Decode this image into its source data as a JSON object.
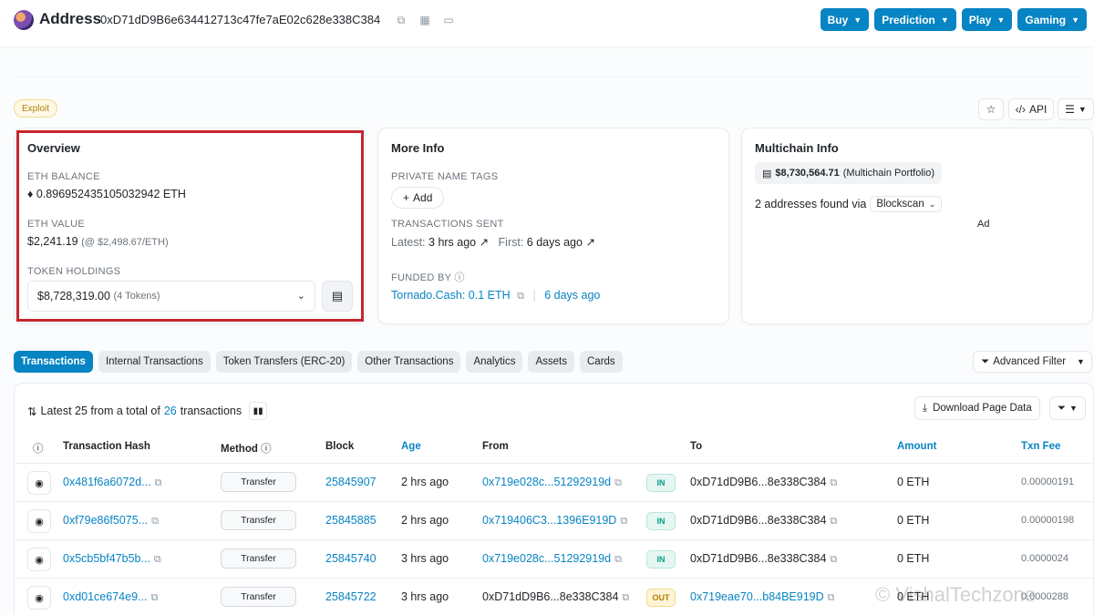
{
  "header": {
    "title": "Address",
    "address": "0xD71dD9B6e634412713c47fe7aE02c628e338C384",
    "nav": [
      "Buy",
      "Prediction",
      "Play",
      "Gaming"
    ]
  },
  "badge": {
    "label": "Exploit"
  },
  "toolbar": {
    "api_label": "API"
  },
  "overview": {
    "title": "Overview",
    "eth_balance_label": "ETH BALANCE",
    "eth_balance": "0.896952435105032942 ETH",
    "eth_value_label": "ETH VALUE",
    "eth_value": "$2,241.19",
    "eth_price": "(@ $2,498.67/ETH)",
    "token_holdings_label": "TOKEN HOLDINGS",
    "token_value": "$8,728,319.00",
    "token_count": "(4 Tokens)"
  },
  "more_info": {
    "title": "More Info",
    "private_tags_label": "PRIVATE NAME TAGS",
    "add_label": "Add",
    "tx_sent_label": "TRANSACTIONS SENT",
    "latest_label": "Latest:",
    "latest_value": "3 hrs ago",
    "first_label": "First:",
    "first_value": "6 days ago",
    "funded_by_label": "FUNDED BY",
    "funded_by_value": "Tornado.Cash: 0.1 ETH",
    "funded_by_age": "6 days ago"
  },
  "multichain": {
    "title": "Multichain Info",
    "portfolio_value": "$8,730,564.71",
    "portfolio_label": "(Multichain Portfolio)",
    "found_text": "2 addresses found via",
    "found_via": "Blockscan",
    "ad_label": "Ad"
  },
  "tabs": [
    "Transactions",
    "Internal Transactions",
    "Token Transfers (ERC-20)",
    "Other Transactions",
    "Analytics",
    "Assets",
    "Cards"
  ],
  "advanced_filter_label": "Advanced Filter",
  "table": {
    "summary_prefix": "Latest 25 from a total of",
    "summary_count": "26",
    "summary_suffix": "transactions",
    "download_label": "Download Page Data",
    "headers": {
      "hash": "Transaction Hash",
      "method": "Method",
      "block": "Block",
      "age": "Age",
      "from": "From",
      "to": "To",
      "amount": "Amount",
      "fee": "Txn Fee"
    },
    "rows": [
      {
        "hash": "0x481f6a6072d...",
        "method": "Transfer",
        "block": "25845907",
        "age": "2 hrs ago",
        "from": "0x719e028c...51292919d",
        "dir": "IN",
        "to": "0xD71dD9B6...8e338C384",
        "amount": "0 ETH",
        "fee": "0.00000191"
      },
      {
        "hash": "0xf79e86f5075...",
        "method": "Transfer",
        "block": "25845885",
        "age": "2 hrs ago",
        "from": "0x719406C3...1396E919D",
        "dir": "IN",
        "to": "0xD71dD9B6...8e338C384",
        "amount": "0 ETH",
        "fee": "0.00000198"
      },
      {
        "hash": "0x5cb5bf47b5b...",
        "method": "Transfer",
        "block": "25845740",
        "age": "3 hrs ago",
        "from": "0x719e028c...51292919d",
        "dir": "IN",
        "to": "0xD71dD9B6...8e338C384",
        "amount": "0 ETH",
        "fee": "0.0000024"
      },
      {
        "hash": "0xd01ce674e9...",
        "method": "Transfer",
        "block": "25845722",
        "age": "3 hrs ago",
        "from": "0xD71dD9B6...8e338C384",
        "dir": "OUT",
        "to": "0x719eae70...b84BE919D",
        "amount": "0 ETH",
        "fee": "0.0000288"
      }
    ]
  },
  "watermark": "© VishalTechzone",
  "colors": {
    "accent": "#0784c3",
    "highlight_border": "#c4262e",
    "in_badge": "#00a186",
    "out_badge": "#b47d00"
  }
}
